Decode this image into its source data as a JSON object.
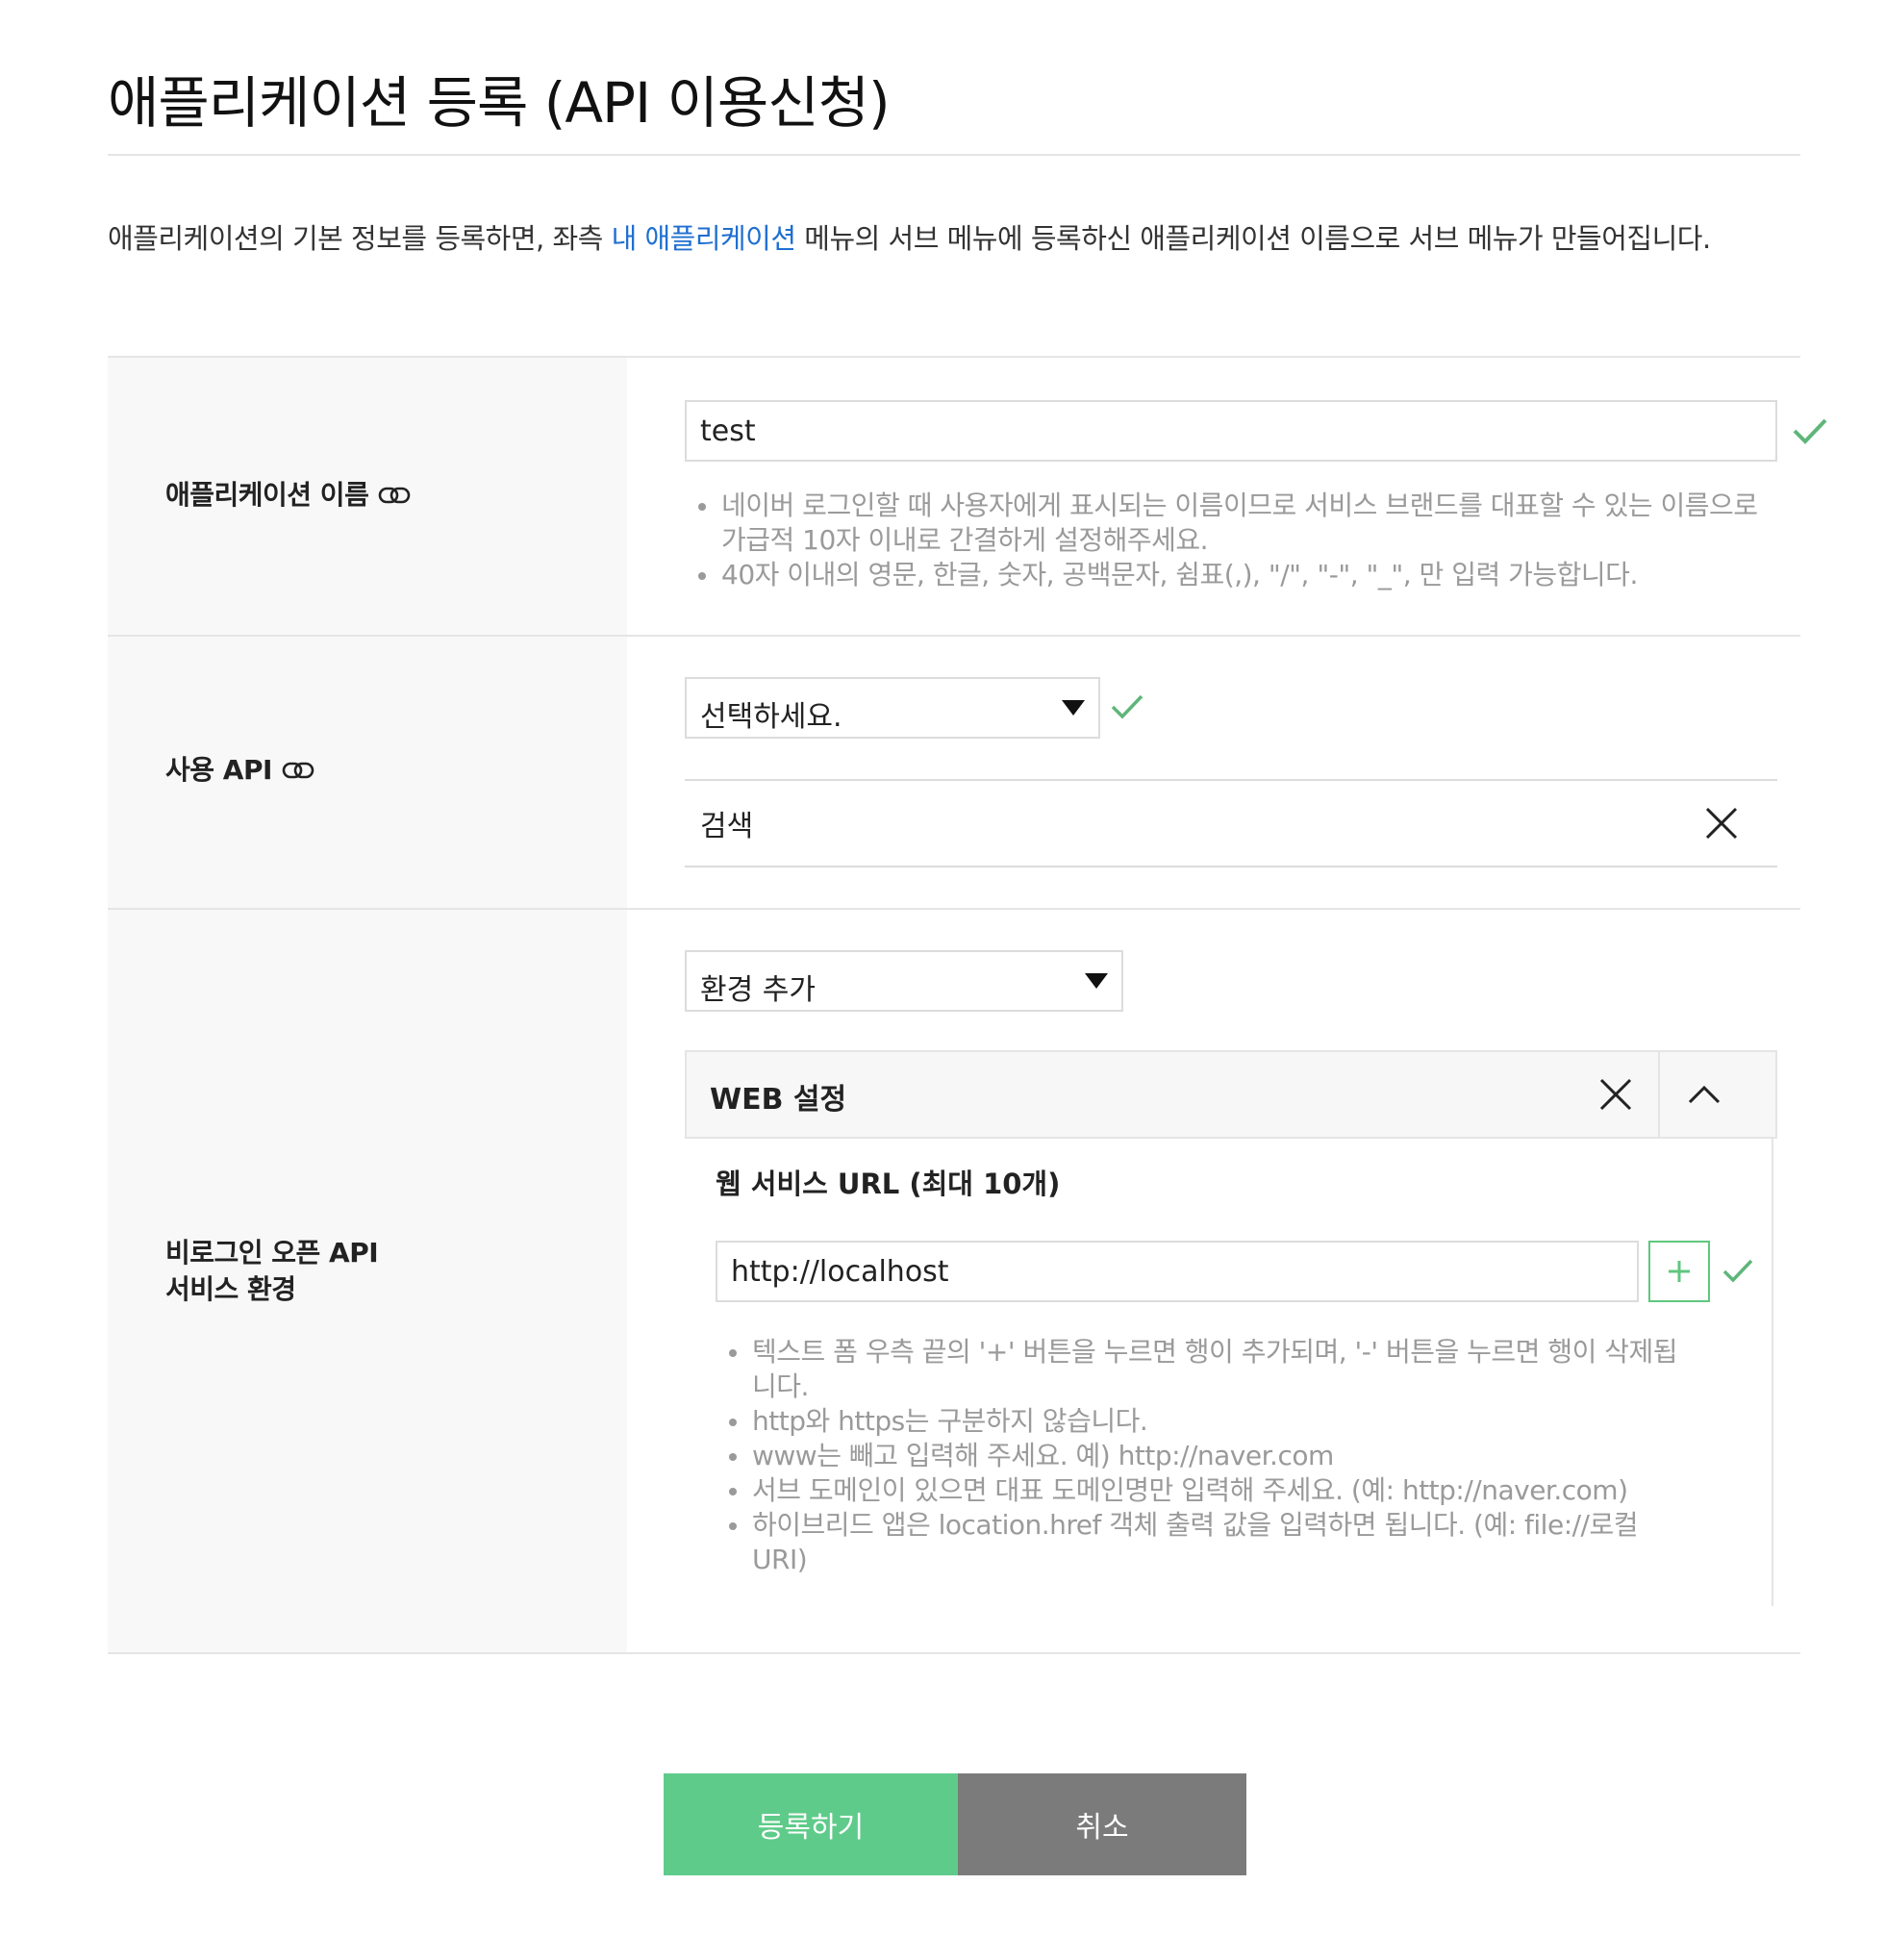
{
  "page": {
    "title": "애플리케이션 등록 (API 이용신청)",
    "intro_before": "애플리케이션의 기본 정보를 등록하면, 좌측 ",
    "intro_link": "내 애플리케이션",
    "intro_after": " 메뉴의 서브 메뉴에 등록하신 애플리케이션 이름으로 서브 메뉴가 만들어집니다."
  },
  "app_name": {
    "label": "애플리케이션 이름",
    "value": "test",
    "help": [
      "네이버 로그인할 때 사용자에게 표시되는 이름이므로 서비스 브랜드를 대표할 수 있는 이름으로 가급적 10자 이내로 간결하게 설정해주세요.",
      "40자 이내의 영문, 한글, 숫자, 공백문자, 쉼표(,), \"/\", \"-\", \"_\", 만 입력 가능합니다."
    ]
  },
  "api": {
    "label": "사용 API",
    "select_value": "선택하세요.",
    "selected_item": "검색"
  },
  "env": {
    "label_line1": "비로그인 오픈 API",
    "label_line2": "서비스 환경",
    "select_value": "환경 추가",
    "panel_title": "WEB 설정",
    "url_heading": "웹 서비스 URL (최대 10개)",
    "url_value": "http://localhost",
    "help": [
      "텍스트 폼 우측 끝의 '+' 버튼을 누르면 행이 추가되며, '-' 버튼을 누르면 행이 삭제됩니다.",
      "http와 https는 구분하지 않습니다.",
      "www는 빼고 입력해 주세요. 예) http://naver.com",
      "서브 도메인이 있으면 대표 도메인명만 입력해 주세요. (예: http://naver.com)",
      "하이브리드 앱은 location.href 객체 출력 값을 입력하면 됩니다. (예: file://로컬URI)"
    ]
  },
  "buttons": {
    "submit": "등록하기",
    "cancel": "취소"
  },
  "colors": {
    "accent_green": "#5fcb8a",
    "check_green": "#5fb67a",
    "cancel_gray": "#7b7b7b",
    "link_blue": "#1f6fd1"
  }
}
